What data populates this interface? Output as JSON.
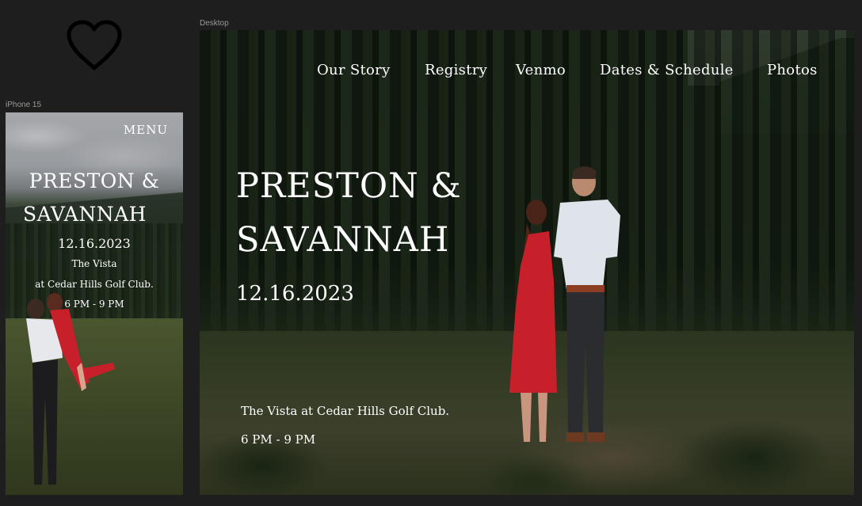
{
  "canvas": {
    "desktop_frame_label": "Desktop",
    "iphone_frame_label": "iPhone 15",
    "logo_icon": "heart-outline-icon",
    "background_color": "#1e1e1e"
  },
  "iphone": {
    "menu_label": "MENU",
    "title_line1": "PRESTON &",
    "title_line2": "SAVANNAH",
    "date": "12.16.2023",
    "venue_line1": "The Vista",
    "venue_line2": "at Cedar Hills Golf Club.",
    "time": "6 PM - 9 PM"
  },
  "desktop": {
    "nav": {
      "our_story": "Our Story",
      "registry": "Registry",
      "venmo": "Venmo",
      "dates_schedule": "Dates & Schedule",
      "photos": "Photos"
    },
    "title_line1": "PRESTON &",
    "title_line2": "SAVANNAH",
    "date": "12.16.2023",
    "venue": "The Vista at Cedar Hills Golf Club.",
    "time": "6 PM - 9 PM"
  },
  "colors": {
    "text": "#ffffff",
    "dress": "#c8202a",
    "shirt": "#dfe4ea"
  }
}
